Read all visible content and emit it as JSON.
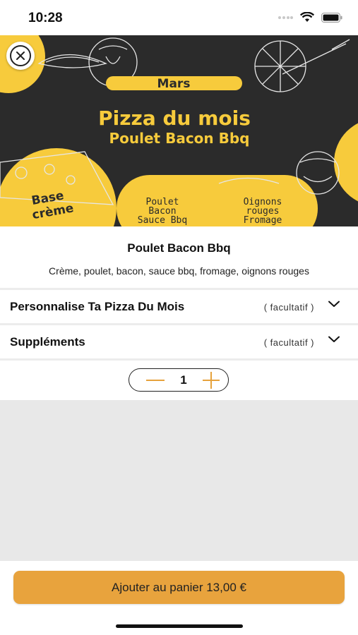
{
  "status_bar": {
    "time": "10:28"
  },
  "hero": {
    "month": "Mars",
    "headline": "Pizza du mois",
    "pizza_name": "Poulet Bacon Bbq",
    "base": [
      "Base",
      "crème"
    ],
    "ingredients_left": [
      "Poulet",
      "Bacon",
      "Sauce Bbq"
    ],
    "ingredients_right": [
      "Oignons",
      "rouges",
      "Fromage"
    ],
    "colors": {
      "background": "#2b2b2b",
      "accent": "#f7cb3c"
    }
  },
  "product": {
    "title": "Poulet Bacon Bbq",
    "description": "Crème, poulet, bacon, sauce bbq, fromage, oignons rouges"
  },
  "options": [
    {
      "label": "Personnalise Ta Pizza Du Mois",
      "tag": "( facultatif )"
    },
    {
      "label": "Suppléments",
      "tag": "( facultatif )"
    }
  ],
  "quantity": "1",
  "cart_button": {
    "label": "Ajouter au panier 13,00 €",
    "color": "#e8a33d"
  }
}
